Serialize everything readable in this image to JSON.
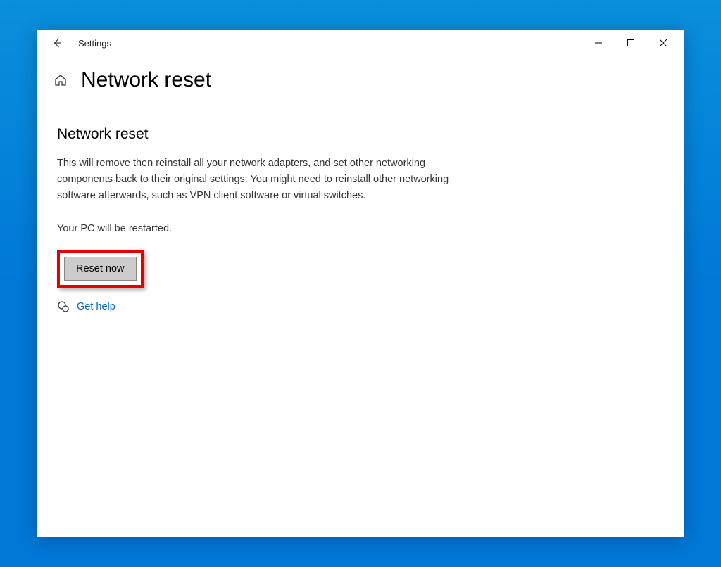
{
  "window": {
    "app_title": "Settings"
  },
  "page": {
    "title": "Network reset",
    "section_heading": "Network reset",
    "description": "This will remove then reinstall all your network adapters, and set other networking components back to their original settings. You might need to reinstall other networking software afterwards, such as VPN client software or virtual switches.",
    "restart_note": "Your PC will be restarted.",
    "reset_button": "Reset now",
    "help_link": "Get help"
  }
}
